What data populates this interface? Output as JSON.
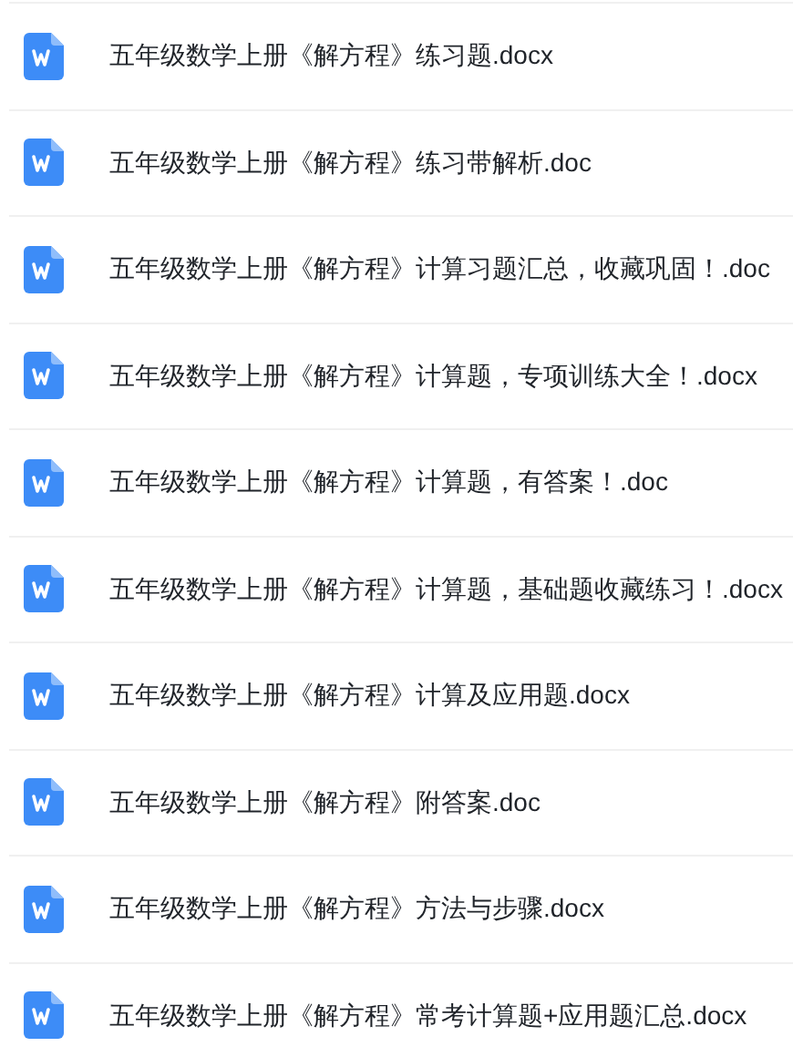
{
  "files": [
    {
      "name": "五年级数学上册《解方程》练习题.docx"
    },
    {
      "name": "五年级数学上册《解方程》练习带解析.doc"
    },
    {
      "name": "五年级数学上册《解方程》计算习题汇总，收藏巩固！.doc"
    },
    {
      "name": "五年级数学上册《解方程》计算题，专项训练大全！.docx"
    },
    {
      "name": "五年级数学上册《解方程》计算题，有答案！.doc"
    },
    {
      "name": "五年级数学上册《解方程》计算题，基础题收藏练习！.docx"
    },
    {
      "name": "五年级数学上册《解方程》计算及应用题.docx"
    },
    {
      "name": "五年级数学上册《解方程》附答案.doc"
    },
    {
      "name": "五年级数学上册《解方程》方法与步骤.docx"
    },
    {
      "name": "五年级数学上册《解方程》常考计算题+应用题汇总.docx"
    }
  ]
}
